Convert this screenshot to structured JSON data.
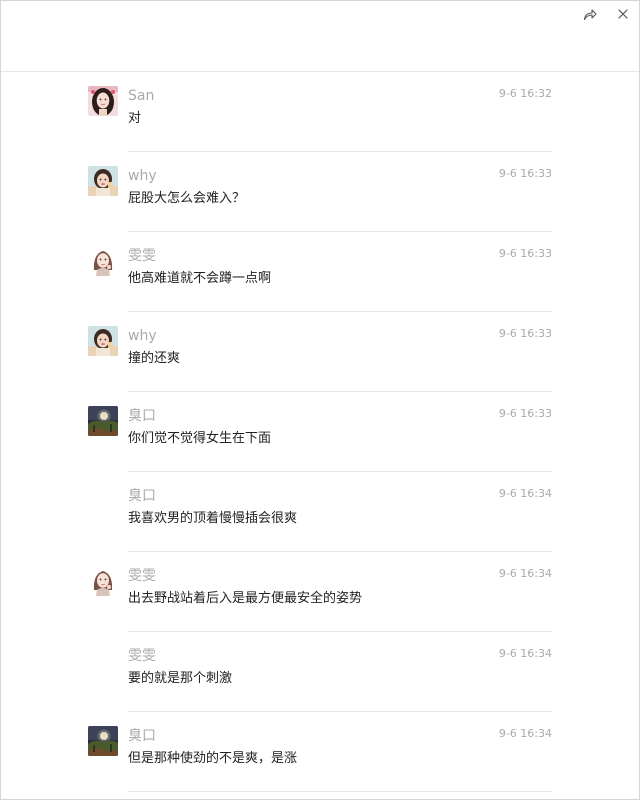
{
  "window": {
    "share_icon": "forward-share-icon",
    "close_icon": "close-icon"
  },
  "messages": [
    {
      "sender": "San",
      "time": "9-6 16:32",
      "text": "对",
      "avatar": "avatar-san"
    },
    {
      "sender": "why",
      "time": "9-6 16:33",
      "text": "屁股大怎么会难入？",
      "avatar": "avatar-why"
    },
    {
      "sender": "雯雯",
      "time": "9-6 16:33",
      "text": "他高难道就不会蹲一点啊",
      "avatar": "avatar-wenwen"
    },
    {
      "sender": "why",
      "time": "9-6 16:33",
      "text": "撞的还爽",
      "avatar": "avatar-why"
    },
    {
      "sender": "臭口",
      "time": "9-6 16:33",
      "text": "你们觉不觉得女生在下面",
      "avatar": "avatar-choukou"
    },
    {
      "sender": "臭口",
      "time": "9-6 16:34",
      "text": "我喜欢男的顶着慢慢插会很爽",
      "avatar": ""
    },
    {
      "sender": "雯雯",
      "time": "9-6 16:34",
      "text": "出去野战站着后入是最方便最安全的姿势",
      "avatar": "avatar-wenwen"
    },
    {
      "sender": "雯雯",
      "time": "9-6 16:34",
      "text": "要的就是那个刺激",
      "avatar": ""
    },
    {
      "sender": "臭口",
      "time": "9-6 16:34",
      "text": "但是那种使劲的不是爽，是涨",
      "avatar": "avatar-choukou"
    }
  ]
}
